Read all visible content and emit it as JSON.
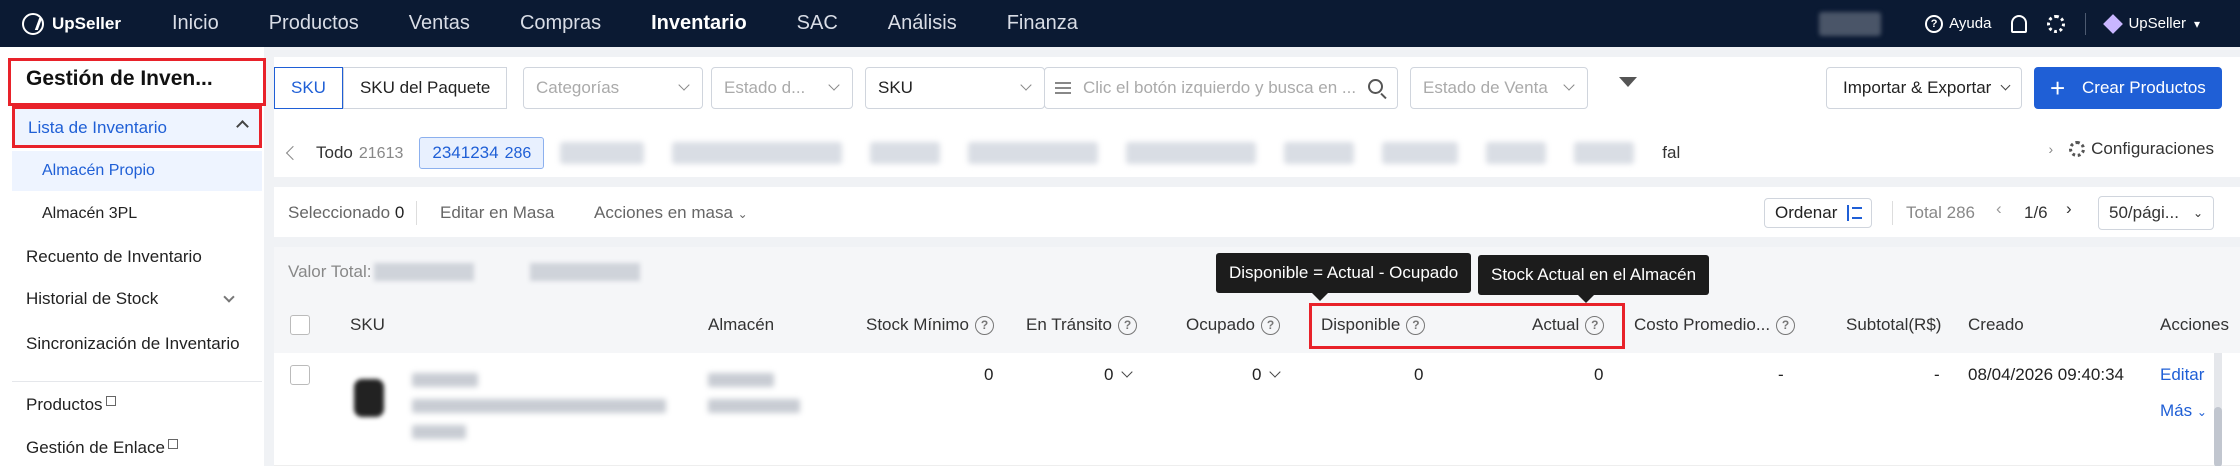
{
  "app": {
    "name": "UpSeller"
  },
  "nav": {
    "items": [
      "Inicio",
      "Productos",
      "Ventas",
      "Compras",
      "Inventario",
      "SAC",
      "Análisis",
      "Finanza"
    ],
    "active_index": 4,
    "help": "Ayuda",
    "user": "UpSeller"
  },
  "sidebar": {
    "title": "Gestión de Inven...",
    "active_group": "Lista de Inventario",
    "sub_items": [
      "Almacén Propio",
      "Almacén 3PL"
    ],
    "items": [
      "Recuento de Inventario",
      "Historial de Stock",
      "Sincronización de Inventario"
    ],
    "links": [
      "Productos",
      "Gestión de Enlace"
    ]
  },
  "filters": {
    "seg_sku": "SKU",
    "seg_package": "SKU del Paquete",
    "categories_placeholder": "Categorías",
    "state_placeholder": "Estado d...",
    "search_type": "SKU",
    "search_placeholder": "Clic el botón izquierdo y busca en ...",
    "sale_state_placeholder": "Estado de Venta",
    "import_export": "Importar & Exportar",
    "create": "Crear Productos"
  },
  "tabs": {
    "all_label": "Todo",
    "all_count": "21613",
    "selected_label": "2341234",
    "selected_count": "286",
    "trailing": "fal",
    "config": "Configuraciones"
  },
  "toolbar": {
    "selected_label": "Seleccionado",
    "selected_count": "0",
    "bulk_edit": "Editar en Masa",
    "bulk_actions": "Acciones en masa",
    "sort": "Ordenar",
    "total": "Total 286",
    "page": "1/6",
    "page_size": "50/pági..."
  },
  "valor": {
    "label": "Valor Total:"
  },
  "table": {
    "headers": {
      "sku": "SKU",
      "almacen": "Almacén",
      "stock_min": "Stock Mínimo",
      "transito": "En Tránsito",
      "ocupado": "Ocupado",
      "disponible": "Disponible",
      "actual": "Actual",
      "costo": "Costo Promedio...",
      "subtotal": "Subtotal(R$)",
      "creado": "Creado",
      "acciones": "Acciones"
    },
    "row": {
      "stock_min": "0",
      "transito": "0",
      "ocupado": "0",
      "disponible": "0",
      "actual": "0",
      "costo": "-",
      "subtotal": "-",
      "creado": "08/04/2026 09:40:34",
      "edit": "Editar",
      "more": "Más"
    }
  },
  "tooltips": {
    "disponible": "Disponible = Actual - Ocupado",
    "actual": "Stock Actual en el Almacén"
  }
}
